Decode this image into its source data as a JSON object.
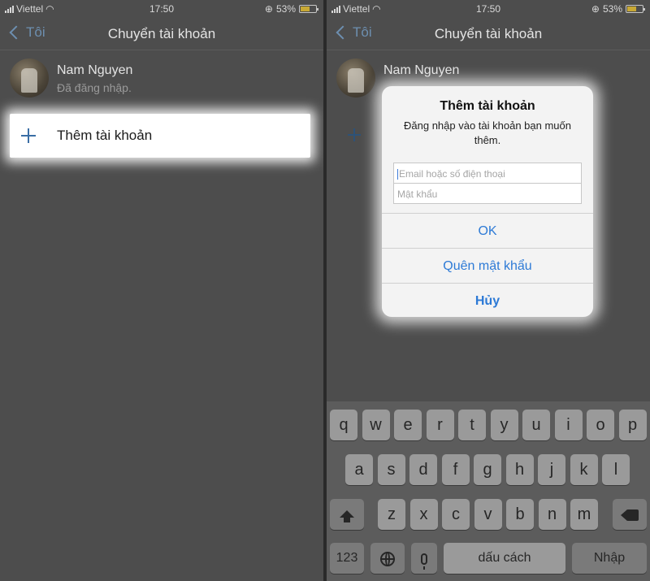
{
  "status_bar": {
    "carrier": "Viettel",
    "time": "17:50",
    "battery": "53%"
  },
  "nav": {
    "back_label": "Tôi",
    "title": "Chuyển tài khoản"
  },
  "account": {
    "name": "Nam Nguyen",
    "status": "Đã đăng nhập."
  },
  "add_account": {
    "label": "Thêm tài khoản"
  },
  "dialog": {
    "title": "Thêm tài khoản",
    "message": "Đăng nhập vào tài khoản bạn muốn thêm.",
    "email_placeholder": "Email hoặc số điện thoại",
    "password_placeholder": "Mật khẩu",
    "ok_label": "OK",
    "forgot_label": "Quên mật khẩu",
    "cancel_label": "Hủy"
  },
  "keyboard": {
    "row1": [
      "q",
      "w",
      "e",
      "r",
      "t",
      "y",
      "u",
      "i",
      "o",
      "p"
    ],
    "row2": [
      "a",
      "s",
      "d",
      "f",
      "g",
      "h",
      "j",
      "k",
      "l"
    ],
    "row3": [
      "z",
      "x",
      "c",
      "v",
      "b",
      "n",
      "m"
    ],
    "numbers_key": "123",
    "space_key": "dấu cách",
    "return_key": "Nhập"
  },
  "colors": {
    "accent": "#2d7ad6",
    "background_dim": "#4d4d4d"
  }
}
